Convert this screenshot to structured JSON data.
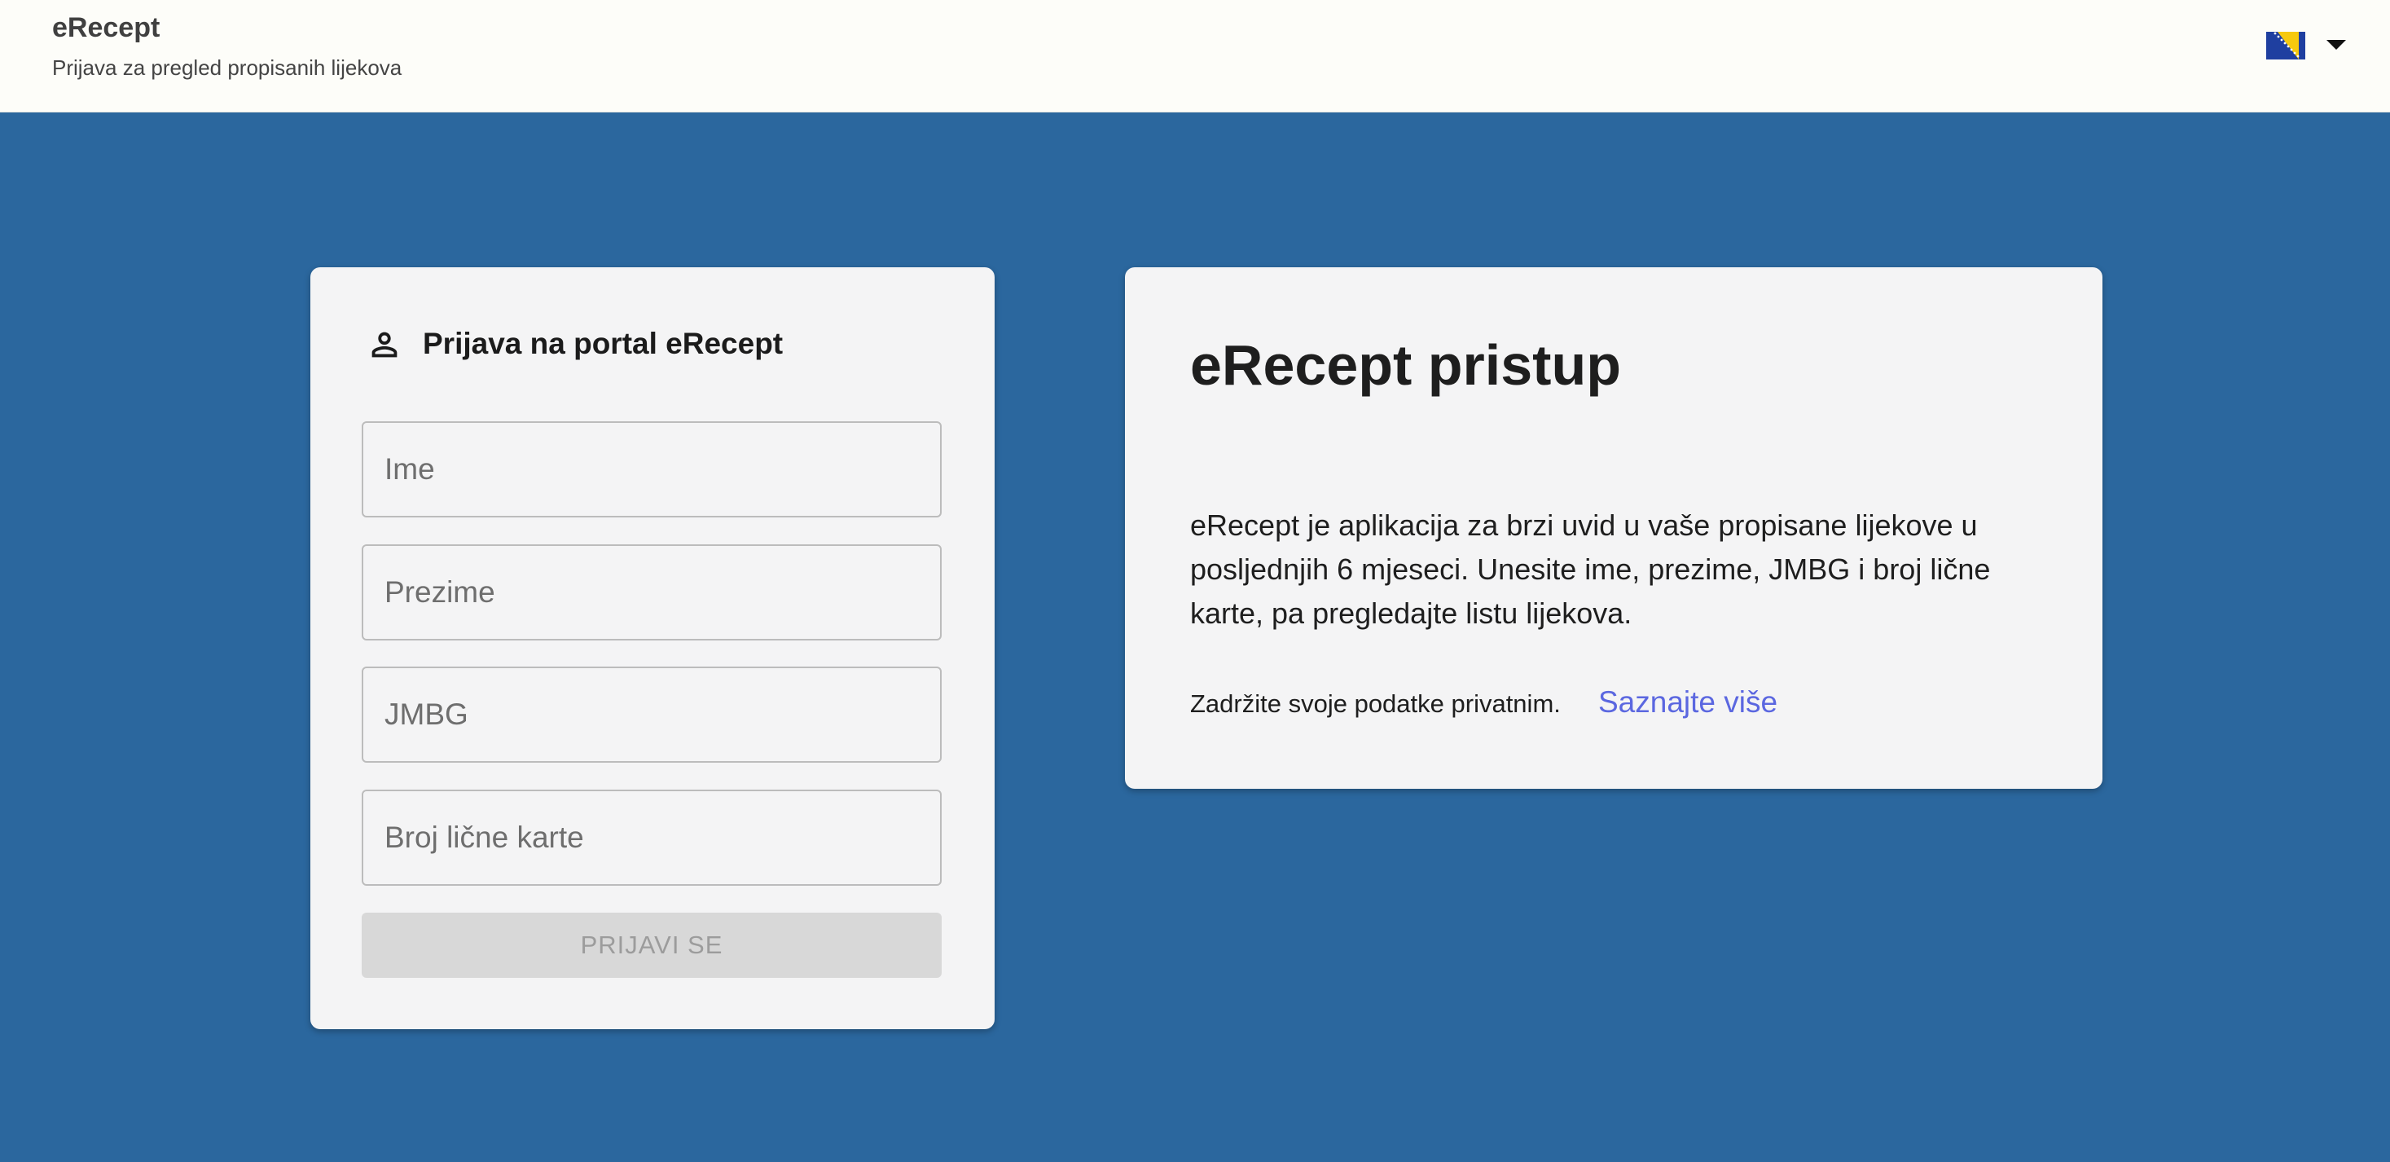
{
  "header": {
    "app_name": "eRecept",
    "subtitle": "Prijava za pregled propisanih lijekova",
    "language_flag": "bosnia-herzegovina-flag-icon"
  },
  "login": {
    "title": "Prijava na portal eRecept",
    "fields": {
      "first_name_placeholder": "Ime",
      "last_name_placeholder": "Prezime",
      "jmbg_placeholder": "JMBG",
      "id_card_placeholder": "Broj lične karte"
    },
    "submit_label": "PRIJAVI SE",
    "submit_enabled": false
  },
  "info": {
    "title": "eRecept pristup",
    "description": "eRecept je aplikacija za brzi uvid u vaše propisane lijekove u posljednjih 6 mjeseci. Unesite ime, prezime, JMBG i broj lične karte, pa pregledajte listu lijekova.",
    "privacy_text": "Zadržite svoje podatke privatnim.",
    "learn_more_label": "Saznajte više"
  },
  "colors": {
    "background": "#2b679e",
    "link": "#5b67e0",
    "card": "#f4f4f5"
  }
}
